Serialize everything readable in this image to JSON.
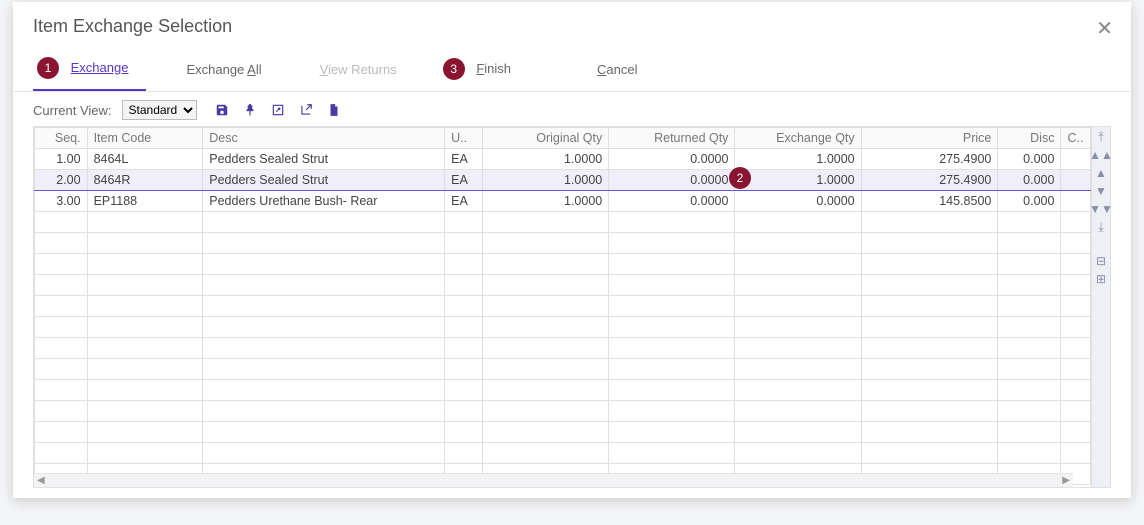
{
  "dialog": {
    "title": "Item Exchange Selection"
  },
  "tabs": {
    "exchange": {
      "label": "Exchange",
      "underline_first": true
    },
    "exchange_all": {
      "label_pre": "Exchange ",
      "underline": "A",
      "label_post": "ll"
    },
    "view_returns": {
      "label_pre": "",
      "underline": "V",
      "label_post": "iew Returns"
    },
    "finish": {
      "label_pre": "",
      "underline": "F",
      "label_post": "inish"
    },
    "cancel": {
      "label_pre": "",
      "underline": "C",
      "label_post": "ancel"
    }
  },
  "callouts": {
    "one": "1",
    "two": "2",
    "three": "3"
  },
  "toolbar": {
    "view_label": "Current View:",
    "view_options": [
      "Standard"
    ],
    "view_selected": "Standard"
  },
  "columns": {
    "seq": "Seq.",
    "item": "Item Code",
    "desc": "Desc",
    "uom": "U..",
    "oqty": "Original Qty",
    "rqty": "Returned Qty",
    "eqty": "Exchange Qty",
    "price": "Price",
    "disc": "Disc",
    "c": "C.."
  },
  "rows": [
    {
      "seq": "1.00",
      "item": "8464L",
      "desc": "Pedders Sealed Strut",
      "uom": "EA",
      "oqty": "1.0000",
      "rqty": "0.0000",
      "eqty": "1.0000",
      "price": "275.4900",
      "disc": "0.000",
      "c": "",
      "selected": false
    },
    {
      "seq": "2.00",
      "item": "8464R",
      "desc": "Pedders Sealed Strut",
      "uom": "EA",
      "oqty": "1.0000",
      "rqty": "0.0000",
      "eqty": "1.0000",
      "price": "275.4900",
      "disc": "0.000",
      "c": "",
      "selected": true
    },
    {
      "seq": "3.00",
      "item": "EP1188",
      "desc": "Pedders Urethane Bush- Rear",
      "uom": "EA",
      "oqty": "1.0000",
      "rqty": "0.0000",
      "eqty": "0.0000",
      "price": "145.8500",
      "disc": "0.000",
      "c": "",
      "selected": false
    }
  ]
}
